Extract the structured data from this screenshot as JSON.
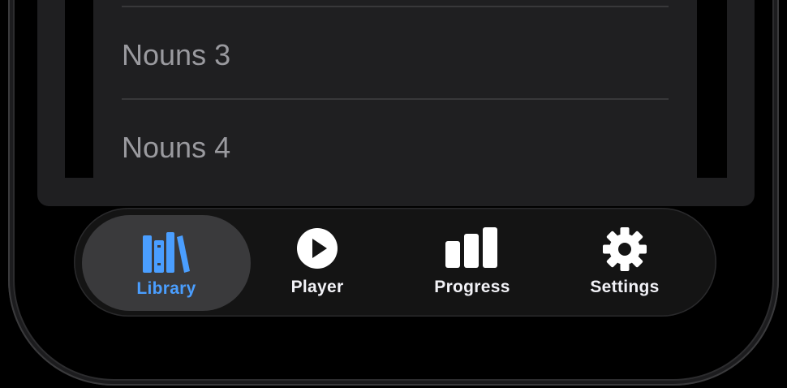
{
  "list": {
    "items": [
      {
        "label": "Nouns 3"
      },
      {
        "label": "Nouns 4"
      }
    ]
  },
  "tabbar": {
    "tabs": [
      {
        "label": "Library",
        "icon": "library-books-icon",
        "active": true
      },
      {
        "label": "Player",
        "icon": "play-circle-icon",
        "active": false
      },
      {
        "label": "Progress",
        "icon": "bar-chart-icon",
        "active": false
      },
      {
        "label": "Settings",
        "icon": "gear-icon",
        "active": false
      }
    ]
  },
  "colors": {
    "accent": "#4a9eff",
    "background": "#000000",
    "panel": "#1f1f21",
    "tabbar": "#141414",
    "active_tab": "#3a3a3c"
  }
}
